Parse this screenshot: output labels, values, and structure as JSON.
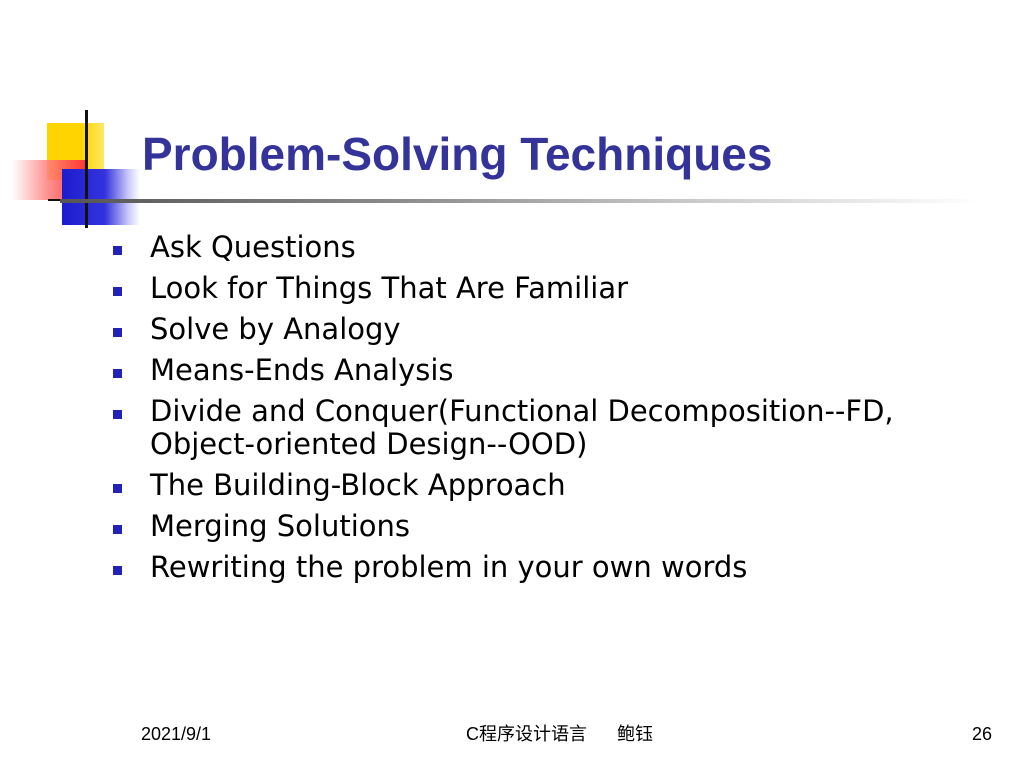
{
  "slide": {
    "title": "Problem-Solving Techniques",
    "bullets": [
      {
        "text": "Ask Questions"
      },
      {
        "text": "Look for Things That Are Familiar"
      },
      {
        "text": "Solve by Analogy"
      },
      {
        "text": "Means-Ends Analysis"
      },
      {
        "text": "Divide and Conquer(Functional Decomposition--FD,\nObject-oriented Design--OOD)"
      },
      {
        "text": "The Building-Block Approach"
      },
      {
        "text": "Merging Solutions"
      },
      {
        "text": "Rewriting the problem in your own words"
      }
    ]
  },
  "footer": {
    "date": "2021/9/1",
    "center": "C程序设计语言      鲍钰",
    "page_number": "26"
  },
  "colors": {
    "title": "#33339a",
    "bullet_marker": "#2222bb",
    "deco_yellow": "#ffd400",
    "deco_red": "#ff3030",
    "deco_blue": "#1c1cd0"
  }
}
